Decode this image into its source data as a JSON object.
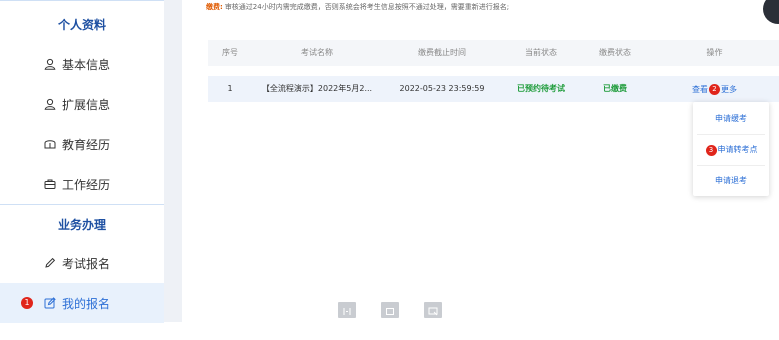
{
  "sidebar": {
    "section1_title": "个人资料",
    "section2_title": "业务办理",
    "items": [
      {
        "label": "基本信息",
        "icon": "user-icon"
      },
      {
        "label": "扩展信息",
        "icon": "user-icon"
      },
      {
        "label": "教育经历",
        "icon": "education-icon"
      },
      {
        "label": "工作经历",
        "icon": "briefcase-icon"
      },
      {
        "label": "考试报名",
        "icon": "pencil-icon"
      },
      {
        "label": "我的报名",
        "icon": "edit-icon",
        "active": true
      }
    ],
    "step_badge": "1"
  },
  "notice": {
    "tag": "缴费:",
    "text": "审核通过24小时内需完成缴费，否则系统会将考生信息按照不通过处理，需要重新进行报名;"
  },
  "table": {
    "headers": [
      "序号",
      "考试名称",
      "缴费截止时间",
      "当前状态",
      "缴费状态",
      "操作"
    ],
    "rows": [
      {
        "index": "1",
        "name": "【全流程演示】2022年5月2...",
        "deadline": "2022-05-23 23:59:59",
        "status": "已预约待考试",
        "pay_status": "已缴费",
        "op_view": "查看",
        "op_more": "更多",
        "op_badge": "2"
      }
    ]
  },
  "dropdown": {
    "items": [
      "申请缓考",
      "申请转考点",
      "申请退考"
    ],
    "badge": "3"
  },
  "colors": {
    "accent": "#2c6fd6",
    "section_title": "#1e50a2",
    "success": "#1f9c3b",
    "badge": "#e0251b"
  }
}
